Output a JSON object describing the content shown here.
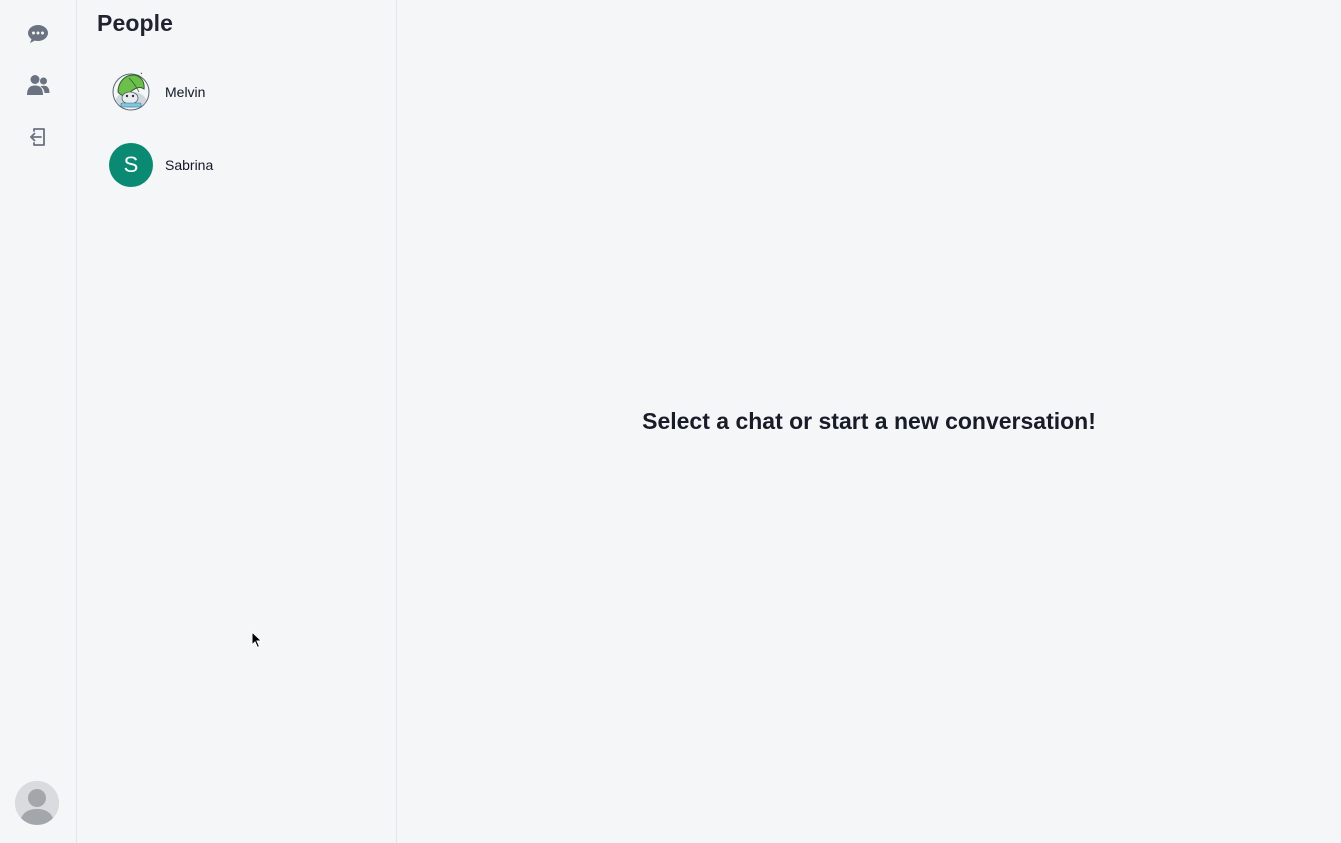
{
  "sidebar": {
    "icons": [
      {
        "name": "chat-bubble-icon",
        "color": "#6b7280"
      },
      {
        "name": "people-icon",
        "color": "#6b7280"
      },
      {
        "name": "logout-icon",
        "color": "#6b7280"
      }
    ],
    "user_avatar": "default-user-avatar"
  },
  "people_panel": {
    "title": "People",
    "items": [
      {
        "name": "Melvin",
        "avatar_type": "image"
      },
      {
        "name": "Sabrina",
        "avatar_type": "letter",
        "avatar_letter": "S",
        "avatar_color": "#0b8a73"
      }
    ]
  },
  "main": {
    "empty_message": "Select a chat or start a new conversation!"
  }
}
